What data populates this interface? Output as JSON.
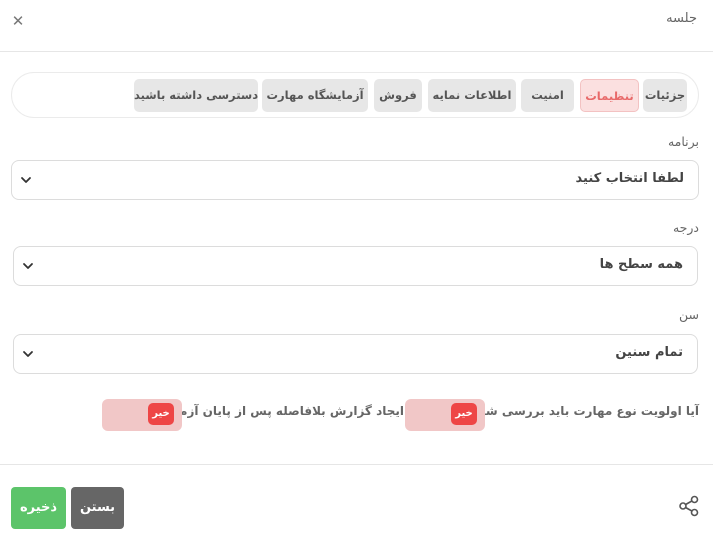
{
  "modal": {
    "title": "جلسه",
    "close_symbol": "✕"
  },
  "tabs": [
    {
      "label": "جزئیات",
      "active": false
    },
    {
      "label": "تنظیمات",
      "active": true
    },
    {
      "label": "امنیت",
      "active": false
    },
    {
      "label": "اطلاعات نمایه",
      "active": false
    },
    {
      "label": "فروش",
      "active": false
    },
    {
      "label": "آزمایشگاه مهارت",
      "active": false
    },
    {
      "label": "دسترسی داشته باشید",
      "active": false
    }
  ],
  "fields": {
    "program": {
      "label": "برنامه",
      "value": "لطفا انتخاب کنید"
    },
    "level": {
      "label": "درجه",
      "value": "همه سطح ها"
    },
    "age": {
      "label": "سن",
      "value": "تمام سنین"
    }
  },
  "toggles": {
    "skill_priority": {
      "label": "آیا اولویت نوع مهارت باید بررسی شود؟",
      "value": "خیر"
    },
    "instant_report": {
      "label": "ایجاد گزارش بلافاصله پس از پایان آزمون",
      "value": "خیر"
    }
  },
  "footer": {
    "save_label": "ذخیره",
    "close_label": "بستن"
  },
  "colors": {
    "active_tab_bg": "#fbe0e0",
    "active_tab_text": "#e86a6a",
    "toggle_bg": "#f1c7c7",
    "toggle_knob": "#ee4646",
    "save": "#5cc46a",
    "close": "#666666"
  },
  "icons": {
    "close": "close-icon",
    "share": "share-icon",
    "dropdown": "chevron-down-icon"
  }
}
